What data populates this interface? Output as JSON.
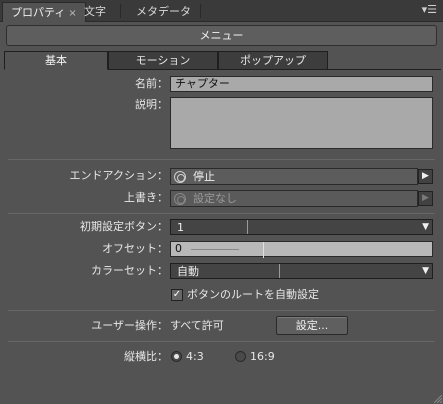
{
  "panel_tabs": [
    {
      "label": "プロパティ",
      "close": "×"
    },
    {
      "label": "文字"
    },
    {
      "label": "メタデータ"
    }
  ],
  "panel_menu_icon": "panel-menu-icon",
  "menu_button": {
    "label": "メニュー"
  },
  "sub_tabs": [
    "基本",
    "モーション",
    "ポップアップ"
  ],
  "fields": {
    "name": {
      "label": "名前：",
      "value": "チャプター"
    },
    "description": {
      "label": "説明：",
      "value": ""
    }
  },
  "end_action": {
    "label": "エンドアクション：",
    "value": "停止"
  },
  "override": {
    "label": "上書き：",
    "value": "設定なし"
  },
  "initial_button": {
    "label": "初期設定ボタン：",
    "value": "1"
  },
  "offset": {
    "label": "オフセット：",
    "value": "0"
  },
  "color_set": {
    "label": "カラーセット：",
    "value": "自動"
  },
  "auto_route": {
    "label": "ボタンのルートを自動設定",
    "checked": true
  },
  "user_ops": {
    "label": "ユーザー操作：",
    "value": "すべて許可",
    "button": "設定..."
  },
  "aspect": {
    "label": "縦横比：",
    "options": [
      {
        "label": "4:3",
        "selected": true
      },
      {
        "label": "16:9",
        "selected": false
      }
    ]
  },
  "colors": {
    "panel_bg": "#535353",
    "tab_bar_bg": "#3a3a3a",
    "textbox_bg": "#a9a9a9"
  }
}
